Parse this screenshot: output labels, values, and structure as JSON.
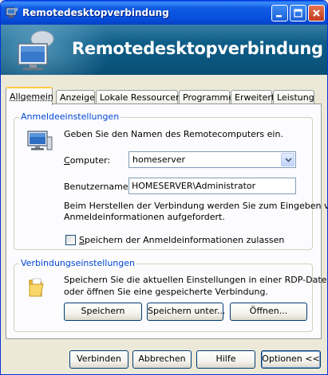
{
  "window": {
    "title": "Remotedesktopverbindung",
    "banner_title": "Remotedesktopverbindung",
    "controls": [
      "minimize",
      "maximize",
      "close"
    ]
  },
  "tabs": [
    {
      "label": "Allgemein",
      "active": true
    },
    {
      "label": "Anzeige",
      "active": false
    },
    {
      "label": "Lokale Ressourcen",
      "active": false
    },
    {
      "label": "Programme",
      "active": false
    },
    {
      "label": "Erweitert",
      "active": false
    },
    {
      "label": "Leistung",
      "active": false
    }
  ],
  "logon": {
    "legend": "Anmeldeeinstellungen",
    "intro": "Geben Sie den Namen des Remotecomputers ein.",
    "computer_label_u": "C",
    "computer_label_rest": "omputer:",
    "computer_value": "homeserver",
    "user_label": "Benutzername:",
    "user_value": "HOMESERVER\\Administrator",
    "note_line1": "Beim Herstellen der Verbindung werden Sie zum Eingeben von",
    "note_line2": "Anmeldeinformationen aufgefordert.",
    "save_creds_u": "S",
    "save_creds_rest": "peichern der Anmeldeinformationen zulassen",
    "save_creds_checked": false
  },
  "connection": {
    "legend": "Verbindungseinstellungen",
    "desc_line1": "Speichern Sie die aktuellen Einstellungen in einer RDP-Datei",
    "desc_line2": "oder öffnen Sie eine gespeicherte Verbindung.",
    "save_button": "Speichern",
    "save_as_button": "Speichern unter...",
    "open_button": "Öffnen..."
  },
  "footer": {
    "connect_button": "Verbinden",
    "cancel_button": "Abbrechen",
    "help_button": "Hilfe",
    "options_button": "Optionen <<"
  },
  "colors": {
    "titlebar": "#0851de",
    "banner": "#0d5c86",
    "legend_text": "#0046d5",
    "dialog_bg": "#ece9d8",
    "active_tab_highlight": "#ffc73c"
  }
}
